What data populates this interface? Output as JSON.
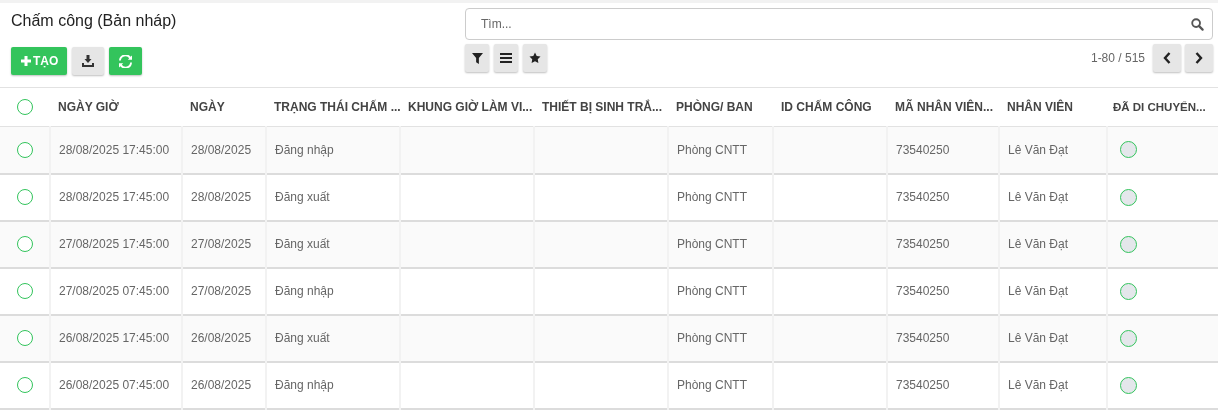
{
  "title": "Chấm công (Bản nháp)",
  "toolbar": {
    "create_label": "TẠO"
  },
  "search": {
    "placeholder": "Tìm..."
  },
  "pager": {
    "range": "1-80 / 515"
  },
  "table": {
    "select_all": false,
    "columns": [
      "NGÀY GIỜ",
      "NGÀY",
      "TRẠNG THÁI CHẤM ...",
      "KHUNG GIỜ LÀM VI...",
      "THIẾT BỊ SINH TRẮ...",
      "PHÒNG/ BAN",
      "ID CHẤM CÔNG",
      "MÃ NHÂN VIÊN...",
      "NHÂN VIÊN",
      "ĐÃ DI CHUYỂN..."
    ],
    "rows": [
      {
        "selected": false,
        "cells": [
          "28/08/2025 17:45:00",
          "28/08/2025",
          "Đăng nhập",
          "",
          "",
          "Phòng CNTT",
          "",
          "73540250",
          "Lê Văn Đạt"
        ],
        "moved": false
      },
      {
        "selected": false,
        "cells": [
          "28/08/2025 17:45:00",
          "28/08/2025",
          "Đăng xuất",
          "",
          "",
          "Phòng CNTT",
          "",
          "73540250",
          "Lê Văn Đạt"
        ],
        "moved": false
      },
      {
        "selected": false,
        "cells": [
          "27/08/2025 17:45:00",
          "27/08/2025",
          "Đăng xuất",
          "",
          "",
          "Phòng CNTT",
          "",
          "73540250",
          "Lê Văn Đạt"
        ],
        "moved": false
      },
      {
        "selected": false,
        "cells": [
          "27/08/2025 07:45:00",
          "27/08/2025",
          "Đăng nhập",
          "",
          "",
          "Phòng CNTT",
          "",
          "73540250",
          "Lê Văn Đạt"
        ],
        "moved": false
      },
      {
        "selected": false,
        "cells": [
          "26/08/2025 17:45:00",
          "26/08/2025",
          "Đăng xuất",
          "",
          "",
          "Phòng CNTT",
          "",
          "73540250",
          "Lê Văn Đạt"
        ],
        "moved": false
      },
      {
        "selected": false,
        "cells": [
          "26/08/2025 07:45:00",
          "26/08/2025",
          "Đăng nhập",
          "",
          "",
          "Phòng CNTT",
          "",
          "73540250",
          "Lê Văn Đạt"
        ],
        "moved": false
      }
    ]
  }
}
